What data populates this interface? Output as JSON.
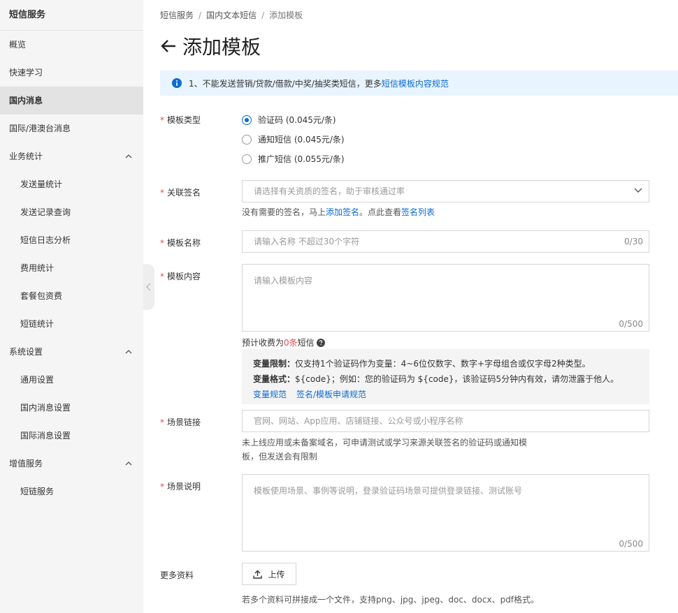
{
  "sidebar": {
    "title": "短信服务",
    "items": [
      {
        "label": "概览"
      },
      {
        "label": "快速学习"
      },
      {
        "label": "国内消息"
      },
      {
        "label": "国际/港澳台消息"
      },
      {
        "label": "业务统计"
      },
      {
        "label": "发送量统计"
      },
      {
        "label": "发送记录查询"
      },
      {
        "label": "短信日志分析"
      },
      {
        "label": "费用统计"
      },
      {
        "label": "套餐包资费"
      },
      {
        "label": "短链统计"
      },
      {
        "label": "系统设置"
      },
      {
        "label": "通用设置"
      },
      {
        "label": "国内消息设置"
      },
      {
        "label": "国际消息设置"
      },
      {
        "label": "增值服务"
      },
      {
        "label": "短链服务"
      }
    ]
  },
  "breadcrumb": [
    "短信服务",
    "国内文本短信",
    "添加模板"
  ],
  "breadcrumb_sep": "/",
  "page_title": "添加模板",
  "notice": {
    "text": "1、不能发送营销/贷款/借款/中奖/抽奖类短信，更多",
    "link": "短信模板内容规范"
  },
  "form": {
    "template_type": {
      "label": "模板类型",
      "options": [
        "验证码 (0.045元/条)",
        "通知短信 (0.045元/条)",
        "推广短信 (0.055元/条)"
      ],
      "selected": 0
    },
    "signature": {
      "label": "关联签名",
      "placeholder": "请选择有关资质的签名，助于审核通过率",
      "help_prefix": "没有需要的签名，马上",
      "help_link1": "添加签名",
      "help_mid": "。点此查看",
      "help_link2": "签名列表"
    },
    "name": {
      "label": "模板名称",
      "placeholder": "请输入名称 不超过30个字符",
      "counter": "0/30"
    },
    "content": {
      "label": "模板内容",
      "placeholder": "请输入模板内容",
      "counter": "0/500",
      "cost_prefix": "预计收费为",
      "cost_count": "0条",
      "cost_suffix": "短信",
      "var_limit_label": "变量限制：",
      "var_limit_text": "仅支持1个验证码作为变量：4~6位仅数字、数字+字母组合或仅字母2种类型。",
      "var_format_label": "变量格式：",
      "var_format_text": "${code}；例如：您的验证码为 ${code}，该验证码5分钟内有效，请勿泄露于他人。",
      "link1": "变量规范",
      "link2": "签名/模板申请规范"
    },
    "scene_link": {
      "label": "场景链接",
      "placeholder": "官网、网站、App应用、店铺链接、公众号或小程序名称",
      "help_line1": "未上线应用或未备案域名，可申请测试或学习来源关联签名的验证码或通知模",
      "help_line2": "板，但发送会有限制"
    },
    "scene_desc": {
      "label": "场景说明",
      "placeholder": "模板使用场景、事例等说明，登录验证码场景可提供登录链接、测试账号",
      "counter": "0/500"
    },
    "more": {
      "label": "更多资料",
      "upload_label": "上传",
      "help": "若多个资料可拼接成一个文件，支持png、jpg、jpeg、doc、docx、pdf格式。"
    }
  },
  "required_mark": "*",
  "colors": {
    "link": "#0b6bd1",
    "required": "#e34d4d",
    "notice_bg": "#e8f4ff"
  }
}
